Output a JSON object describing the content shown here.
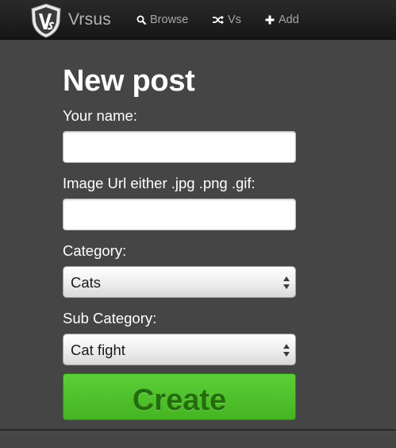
{
  "navbar": {
    "brand": "Vrsus",
    "logo_icon": "vrsus-shield-logo",
    "items": [
      {
        "label": "Browse",
        "icon": "search-icon"
      },
      {
        "label": "Vs",
        "icon": "shuffle-icon"
      },
      {
        "label": "Add",
        "icon": "plus-icon"
      }
    ]
  },
  "form": {
    "title": "New post",
    "name_label": "Your name:",
    "name_value": "",
    "url_label": "Image Url either .jpg .png .gif:",
    "url_value": "",
    "category_label": "Category:",
    "category_value": "Cats",
    "subcategory_label": "Sub Category:",
    "subcategory_value": "Cat fight",
    "submit_label": "Create"
  },
  "colors": {
    "background": "#454545",
    "navbar": "#1e1e1e",
    "create_button": "#4fc22b",
    "create_text": "#236d0c"
  }
}
